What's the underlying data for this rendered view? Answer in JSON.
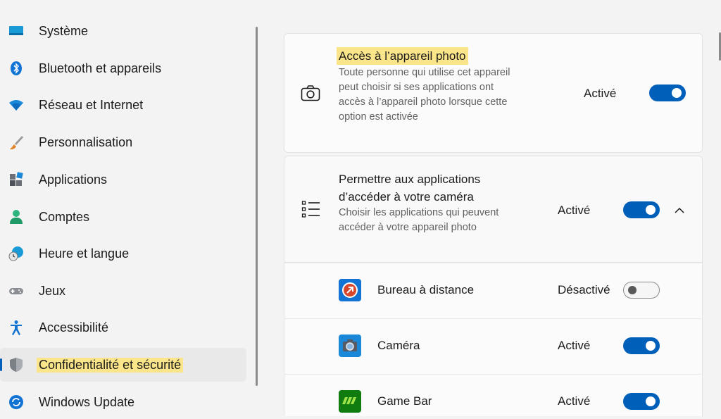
{
  "sidebar": {
    "items": [
      {
        "label": "Système",
        "icon": "system-icon"
      },
      {
        "label": "Bluetooth et appareils",
        "icon": "bluetooth-icon"
      },
      {
        "label": "Réseau et Internet",
        "icon": "wifi-icon"
      },
      {
        "label": "Personnalisation",
        "icon": "brush-icon"
      },
      {
        "label": "Applications",
        "icon": "apps-icon"
      },
      {
        "label": "Comptes",
        "icon": "account-icon"
      },
      {
        "label": "Heure et langue",
        "icon": "time-language-icon"
      },
      {
        "label": "Jeux",
        "icon": "gamepad-icon"
      },
      {
        "label": "Accessibilité",
        "icon": "accessibility-icon"
      },
      {
        "label": "Confidentialité et sécurité",
        "icon": "shield-icon",
        "selected": true
      },
      {
        "label": "Windows Update",
        "icon": "update-icon"
      }
    ]
  },
  "camera_access": {
    "title": "Accès à l’appareil photo",
    "description": "Toute personne qui utilise cet appareil peut choisir si ses applications ont accès à l’appareil photo lorsque cette option est activée",
    "state": "Activé",
    "enabled": true
  },
  "apps_access": {
    "title": "Permettre aux applications d’accéder à votre caméra",
    "description": "Choisir les applications qui peuvent accéder à votre appareil photo",
    "state": "Activé",
    "enabled": true
  },
  "apps": [
    {
      "name": "Bureau à distance",
      "state": "Désactivé",
      "enabled": false,
      "icon": "remote-desktop-icon"
    },
    {
      "name": "Caméra",
      "state": "Activé",
      "enabled": true,
      "icon": "camera-app-icon"
    },
    {
      "name": "Game Bar",
      "state": "Activé",
      "enabled": true,
      "icon": "game-bar-icon"
    }
  ],
  "colors": {
    "accent": "#005fb8",
    "highlight": "#fbe58a"
  }
}
